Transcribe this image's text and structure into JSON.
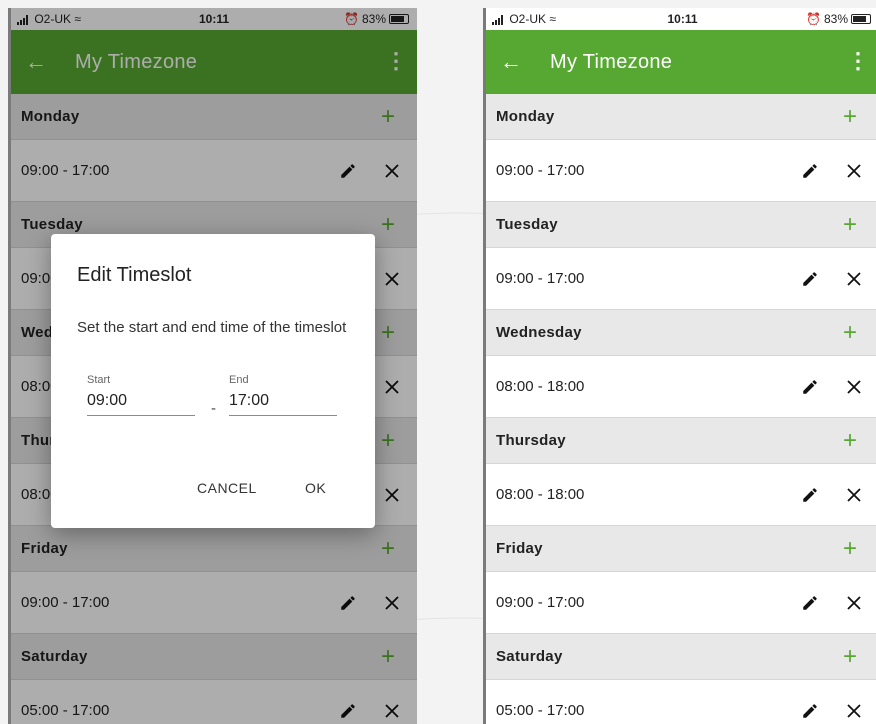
{
  "status": {
    "carrier": "O2-UK",
    "time": "10:11",
    "battery": "83%"
  },
  "appbar": {
    "title": "My Timezone"
  },
  "colors": {
    "primary_dark": "#3a7e1e",
    "primary": "#56a832",
    "row_header": "#e8e8e8"
  },
  "left": {
    "days": [
      {
        "name": "Monday",
        "slots": [
          "09:00 - 17:00"
        ]
      },
      {
        "name": "Tuesday",
        "slots": [
          "09:00 - 17:00"
        ]
      },
      {
        "name": "Wednesday",
        "slots": [
          "08:00 - 18:00"
        ]
      },
      {
        "name": "Thursday",
        "slots": [
          "08:00 - 18:00"
        ]
      },
      {
        "name": "Friday",
        "slots": [
          "09:00 - 17:00"
        ]
      },
      {
        "name": "Saturday",
        "slots": [
          "05:00 - 17:00"
        ]
      }
    ]
  },
  "right": {
    "days": [
      {
        "name": "Monday",
        "slots": [
          "09:00 - 17:00"
        ]
      },
      {
        "name": "Tuesday",
        "slots": [
          "09:00 - 17:00"
        ]
      },
      {
        "name": "Wednesday",
        "slots": [
          "08:00 - 18:00"
        ]
      },
      {
        "name": "Thursday",
        "slots": [
          "08:00 - 18:00"
        ]
      },
      {
        "name": "Friday",
        "slots": [
          "09:00 - 17:00"
        ]
      },
      {
        "name": "Saturday",
        "slots": [
          "05:00 - 17:00"
        ]
      }
    ]
  },
  "dialog": {
    "title": "Edit Timeslot",
    "message": "Set the start and end time of the timeslot",
    "start_label": "Start",
    "start_value": "09:00",
    "separator": "-",
    "end_label": "End",
    "end_value": "17:00",
    "cancel_label": "CANCEL",
    "ok_label": "OK"
  },
  "icons": {
    "back": "arrow-left-icon",
    "menu": "more-vertical-icon",
    "add": "plus-icon",
    "edit": "pencil-icon",
    "delete": "close-icon"
  }
}
